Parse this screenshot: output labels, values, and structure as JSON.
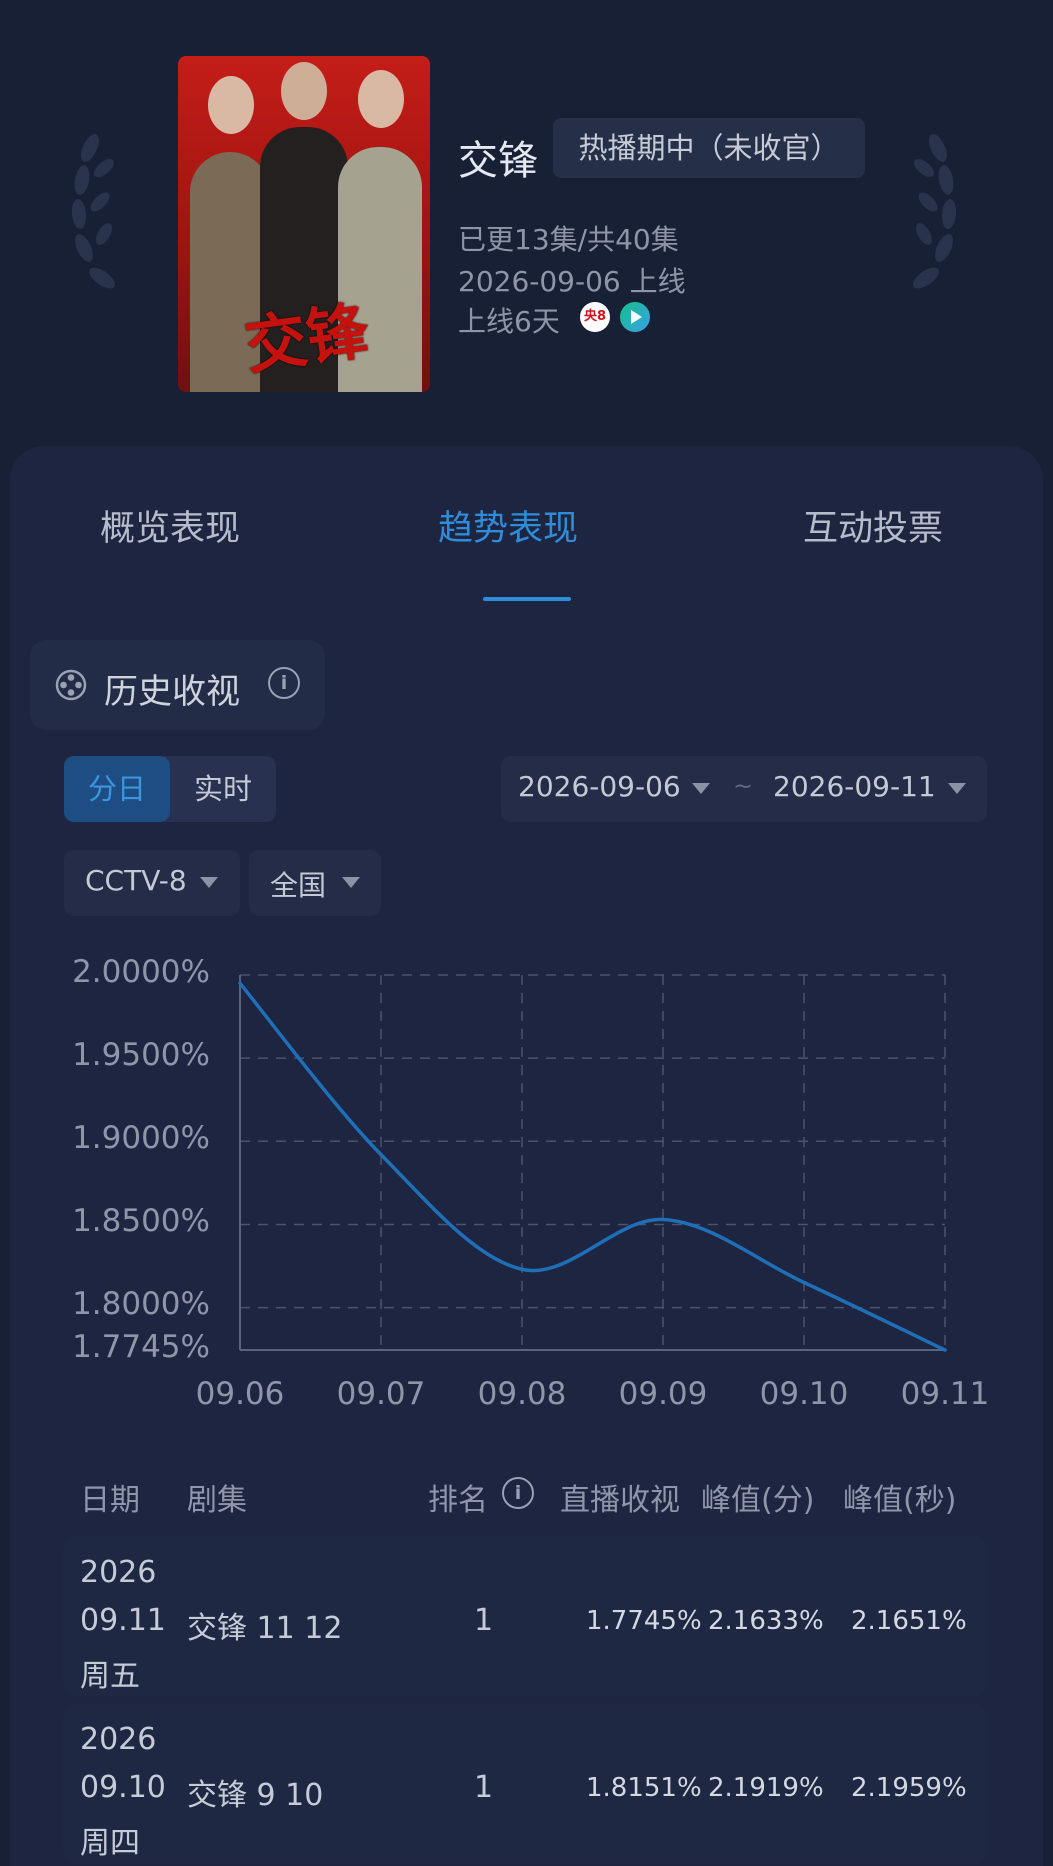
{
  "show": {
    "title": "交锋",
    "status_badge": "热播期中（未收官）",
    "episodes": "已更13集/共40集",
    "premiere": "2026-09-06 上线",
    "days_online": "上线6天",
    "channel_logo_text": "央8",
    "poster_title": "交锋"
  },
  "tabs": [
    "概览表现",
    "趋势表现",
    "互动投票"
  ],
  "active_tab": 1,
  "section": {
    "title": "历史收视",
    "info_icon": "i"
  },
  "granularity": {
    "options": [
      "分日",
      "实时"
    ],
    "selected": "分日"
  },
  "date_range": {
    "start": "2026-09-06",
    "separator": "~",
    "end": "2026-09-11"
  },
  "filters": {
    "channel": "CCTV-8",
    "region": "全国"
  },
  "chart_data": {
    "type": "line",
    "x": [
      "09.06",
      "09.07",
      "09.08",
      "09.09",
      "09.10",
      "09.11"
    ],
    "y_ticks": [
      "2.0000%",
      "1.9500%",
      "1.9000%",
      "1.8500%",
      "1.8000%",
      "1.7745%"
    ],
    "ylim": [
      1.7745,
      2.0
    ],
    "series": [
      {
        "values": [
          1.995,
          1.892,
          1.823,
          1.853,
          1.8151,
          1.7745
        ]
      }
    ],
    "grid": true,
    "line_color": "#1f6fb8"
  },
  "table": {
    "headers": [
      "日期",
      "剧集",
      "排名",
      "直播收视",
      "峰值(分)",
      "峰值(秒)"
    ],
    "rank_info_icon": "i",
    "rows": [
      {
        "year": "2026",
        "date": "09.11",
        "weekday": "周五",
        "episode": "交锋 11 12",
        "rank": "1",
        "live": "1.7745%",
        "peak_min": "2.1633%",
        "peak_sec": "2.1651%"
      },
      {
        "year": "2026",
        "date": "09.10",
        "weekday": "周四",
        "episode": "交锋 9 10",
        "rank": "1",
        "live": "1.8151%",
        "peak_min": "2.1919%",
        "peak_sec": "2.1959%"
      }
    ]
  }
}
